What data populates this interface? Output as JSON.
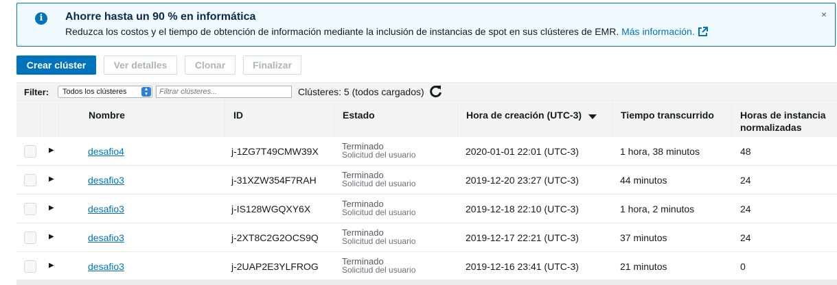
{
  "banner": {
    "title": "Ahorre hasta un 90 % en informática",
    "text": "Reduzca los costos y el tiempo de obtención de información mediante la inclusión de instancias de spot en sus clústeres de EMR. ",
    "link": "Más información.",
    "close": "×",
    "icon": "info-icon"
  },
  "toolbar": {
    "create": "Crear clúster",
    "details": "Ver detalles",
    "clone": "Clonar",
    "terminate": "Finalizar"
  },
  "filter": {
    "label": "Filter:",
    "select_value": "Todos los clústeres",
    "search_placeholder": "Filtrar clústeres...",
    "count": "Clústeres: 5 (todos cargados)"
  },
  "table": {
    "headers": {
      "name": "Nombre",
      "id": "ID",
      "state": "Estado",
      "created": "Hora de creación (UTC-3)",
      "elapsed": "Tiempo transcurrido",
      "hours_line1": "Horas de instancia",
      "hours_line2": "normalizadas"
    },
    "rows": [
      {
        "name": "desafio4",
        "id": "j-1ZG7T49CMW39X",
        "state": "Terminado",
        "reason": "Solicitud del usuario",
        "created": "2020-01-01 22:01 (UTC-3)",
        "elapsed": "1 hora, 38 minutos",
        "hours": "48"
      },
      {
        "name": "desafio3",
        "id": "j-31XZW354F7RAH",
        "state": "Terminado",
        "reason": "Solicitud del usuario",
        "created": "2019-12-20 23:27 (UTC-3)",
        "elapsed": "44 minutos",
        "hours": "24"
      },
      {
        "name": "desafio3",
        "id": "j-IS128WGQXY6X",
        "state": "Terminado",
        "reason": "Solicitud del usuario",
        "created": "2019-12-18 22:10 (UTC-3)",
        "elapsed": "1 hora, 2 minutos",
        "hours": "24"
      },
      {
        "name": "desafio3",
        "id": "j-2XT8C2G2OCS9Q",
        "state": "Terminado",
        "reason": "Solicitud del usuario",
        "created": "2019-12-17 22:21 (UTC-3)",
        "elapsed": "37 minutos",
        "hours": "24"
      },
      {
        "name": "desafio3",
        "id": "j-2UAP2E3YLFROG",
        "state": "Terminado",
        "reason": "Solicitud del usuario",
        "created": "2019-12-16 23:41 (UTC-3)",
        "elapsed": "21 minutos",
        "hours": "0"
      }
    ]
  },
  "colors": {
    "accent": "#0073bb",
    "header_bg": "#f2f3f3",
    "banner_bg": "#f1faff"
  }
}
